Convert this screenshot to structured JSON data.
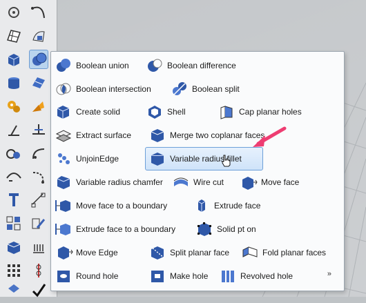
{
  "colors": {
    "accent_blue": "#3c63b5",
    "highlight_bg": "#cfe3f9",
    "highlight_border": "#6c9fd8",
    "arrow_pink": "#ee3d72"
  },
  "toolbar": {
    "icons": [
      "point-icon",
      "curve-icon",
      "surface-icon",
      "surface-edit-icon",
      "box-icon",
      "boolean-icon",
      "cylinder-icon",
      "polysurface-icon",
      "gear-puzzle-icon",
      "orange-arrow-icon",
      "analyze-icon",
      "project-icon",
      "sphere-group-icon",
      "curve-fillet-icon",
      "arc-icon",
      "curve-tool-icon",
      "text-icon",
      "dimension-icon",
      "grid-icon",
      "edit-icon",
      "box-blue-icon",
      "hatch-icon",
      "array-icon",
      "pipe-icon",
      "cap-icon",
      "check-icon"
    ]
  },
  "flyout": {
    "commands": [
      {
        "label": "Boolean union",
        "icon": "boolean-union-icon"
      },
      {
        "label": "Boolean difference",
        "icon": "boolean-difference-icon"
      },
      {
        "label": "Boolean intersection",
        "icon": "boolean-intersection-icon"
      },
      {
        "label": "Boolean split",
        "icon": "boolean-split-icon"
      },
      {
        "label": "Create solid",
        "icon": "create-solid-icon"
      },
      {
        "label": "Shell",
        "icon": "shell-icon"
      },
      {
        "label": "Cap planar holes",
        "icon": "cap-planar-holes-icon"
      },
      {
        "label": "Extract surface",
        "icon": "extract-surface-icon"
      },
      {
        "label": "Merge two coplanar faces",
        "icon": "merge-faces-icon"
      },
      {
        "label": "UnjoinEdge",
        "icon": "unjoin-edge-icon"
      },
      {
        "label": "Variable radius fillet",
        "icon": "variable-radius-fillet-icon"
      },
      {
        "label": "Variable radius chamfer",
        "icon": "variable-radius-chamfer-icon"
      },
      {
        "label": "Wire cut",
        "icon": "wire-cut-icon"
      },
      {
        "label": "Move face",
        "icon": "move-face-icon"
      },
      {
        "label": "Move face to a boundary",
        "icon": "move-face-boundary-icon"
      },
      {
        "label": "Extrude face",
        "icon": "extrude-face-icon"
      },
      {
        "label": "Extrude face to a boundary",
        "icon": "extrude-face-boundary-icon"
      },
      {
        "label": "Solid pt on",
        "icon": "solid-pt-on-icon"
      },
      {
        "label": "Move Edge",
        "icon": "move-edge-icon"
      },
      {
        "label": "Split planar face",
        "icon": "split-planar-face-icon"
      },
      {
        "label": "Fold planar faces",
        "icon": "fold-planar-faces-icon"
      },
      {
        "label": "Round hole",
        "icon": "round-hole-icon"
      },
      {
        "label": "Make hole",
        "icon": "make-hole-icon"
      },
      {
        "label": "Revolved hole",
        "icon": "revolved-hole-icon"
      }
    ],
    "more_label": "»"
  }
}
